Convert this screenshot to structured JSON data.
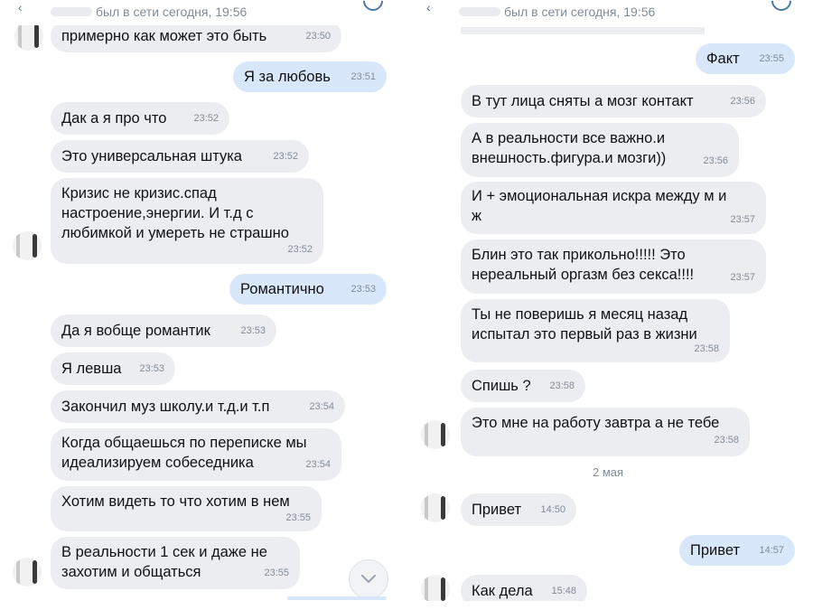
{
  "left_panel": {
    "status": "был в сети сегодня, 19:56",
    "messages": [
      {
        "text": "примерно как может это быть",
        "time": "23:50"
      },
      {
        "text": "Я за любовь",
        "time": "23:51"
      },
      {
        "text": "Дак а я про что",
        "time": "23:52"
      },
      {
        "text": "Это универсальная штука",
        "time": "23:52"
      },
      {
        "line1": "Кризис не кризис.спад",
        "line2": "настроение,энергии. И т.д с",
        "line3": "любимкой и умереть не страшно",
        "time": "23:52"
      },
      {
        "text": "Романтично",
        "time": "23:53"
      },
      {
        "text": "Да я вобще романтик",
        "time": "23:53"
      },
      {
        "text": "Я левша",
        "time": "23:53"
      },
      {
        "text": "Закончил муз школу.и т.д.и т.п",
        "time": "23:54"
      },
      {
        "line1": "Когда общаешься по переписке мы",
        "line2": "идеализируем собеседника",
        "time": "23:54"
      },
      {
        "text": "Хотим видеть то что хотим в нем",
        "time": "23:55"
      },
      {
        "line1": "В реальности 1 сек и даже не",
        "line2": "захотим и общаться",
        "time": "23:55"
      }
    ]
  },
  "right_panel": {
    "status": "был в сети сегодня, 19:56",
    "messages": [
      {
        "text": "Факт",
        "time": "23:55"
      },
      {
        "text": "В тут лица сняты а мозг контакт",
        "time": "23:56"
      },
      {
        "line1": "А в реальности все важно.и",
        "line2": "внешность.фигура.и мозги))",
        "time": "23:56"
      },
      {
        "line1": "И + эмоциональная искра между м и",
        "line2": "ж",
        "time": "23:57"
      },
      {
        "line1": "Блин это так прикольно!!!!! Это",
        "line2": "нереальный оргазм без секса!!!!",
        "time": "23:57"
      },
      {
        "line1": "Ты не поверишь я месяц назад",
        "line2": "испытал это первый раз в жизни",
        "time": "23:58"
      },
      {
        "text": "Спишь ?",
        "time": "23:58"
      },
      {
        "text": "Это мне на работу завтра а не тебе",
        "time": "23:58"
      },
      {
        "text": "Привет",
        "time": "14:50"
      },
      {
        "text": "Привет",
        "time": "14:57"
      },
      {
        "text": "Как дела",
        "time": "15:48"
      }
    ],
    "date_divider": "2 мая"
  },
  "icons": {
    "back": "chevron-left-icon",
    "menu": "menu-icon",
    "scroll_down": "chevron-down-icon"
  },
  "colors": {
    "incoming_bubble": "#ebedf0",
    "outgoing_bubble": "#d9e7fa",
    "time_text": "#818c99",
    "accent": "#4a76a8"
  }
}
